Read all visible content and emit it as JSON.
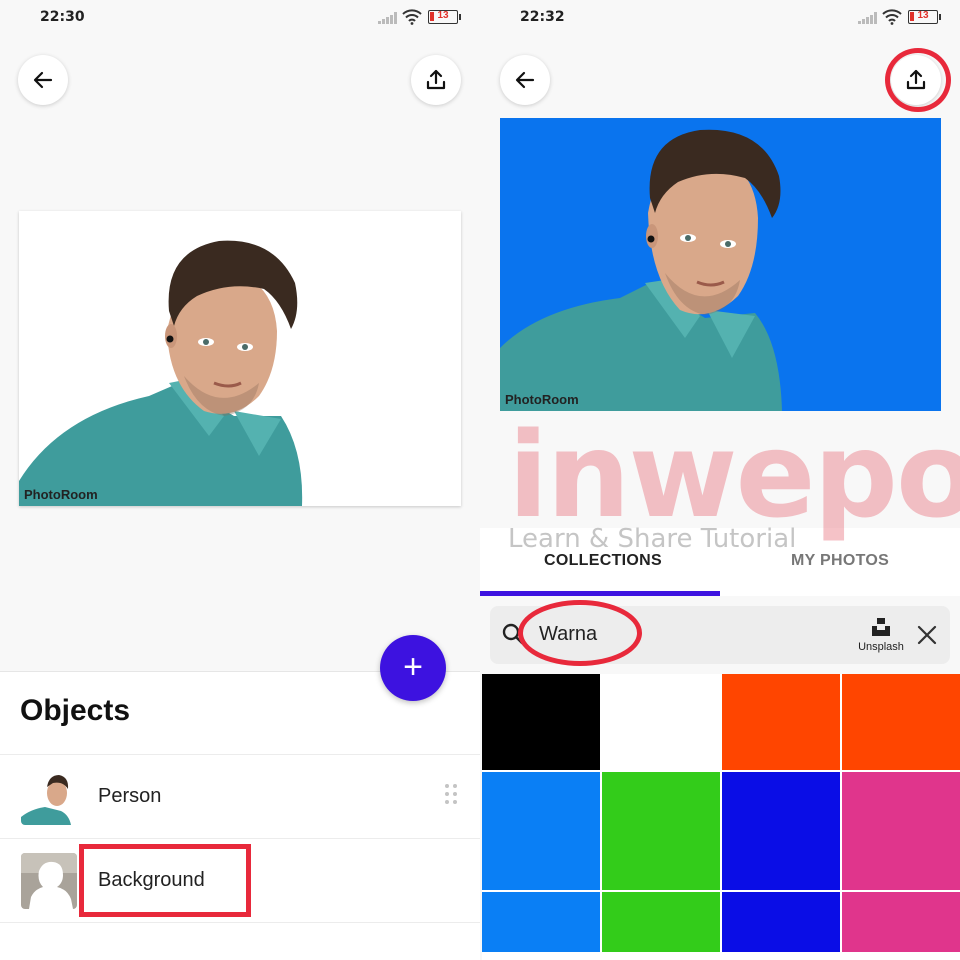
{
  "left_screen": {
    "status": {
      "time": "22:30",
      "battery": "13"
    },
    "watermark": "PhotoRoom",
    "sheet": {
      "title": "Objects",
      "objects": [
        {
          "label": "Person"
        },
        {
          "label": "Background"
        }
      ]
    },
    "fab_label": "+"
  },
  "right_screen": {
    "status": {
      "time": "22:32",
      "battery": "13"
    },
    "watermark": "PhotoRoom",
    "site_watermark": {
      "brand": "inwepo",
      "tagline": "Learn & Share Tutorial"
    },
    "tabs": [
      {
        "label": "COLLECTIONS",
        "active": true
      },
      {
        "label": "MY PHOTOS",
        "active": false
      }
    ],
    "search": {
      "value": "Warna",
      "source": "Unsplash"
    },
    "swatches": [
      "#000000",
      "#ffffff",
      "#ff4500",
      "#ff4500",
      "#0a7ff5",
      "#33cc1a",
      "#0a0de6",
      "#e0358c",
      "#0a7ff5",
      "#33cc1a",
      "#0a0de6",
      "#e0358c"
    ]
  },
  "colors": {
    "accent": "#3d12e0",
    "annotation": "#e8293b",
    "photo_background": "#0a74ee"
  }
}
